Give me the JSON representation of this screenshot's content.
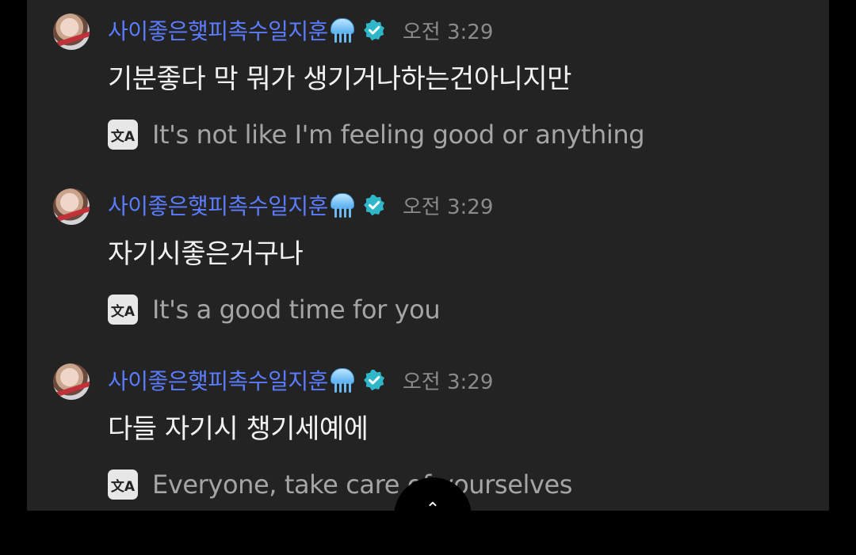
{
  "messages": [
    {
      "username": "사이좋은햋피촉수일지훈",
      "time": "오전 3:29",
      "text": "기분좋다 막 뭐가 생기거나하는건아니지만",
      "translation": "It's not like I'm feeling good or anything"
    },
    {
      "username": "사이좋은햋피촉수일지훈",
      "time": "오전 3:29",
      "text": "자기시좋은거구나",
      "translation": "It's a good time for you"
    },
    {
      "username": "사이좋은햋피촉수일지훈",
      "time": "오전 3:29",
      "text": "다들 자기시 챙기세예에",
      "translation": "Everyone, take care of yourselves"
    }
  ],
  "translate_icon": {
    "glyph": "文A",
    "name": "translate-icon"
  },
  "username_emoji": "jellyfish-emoji",
  "badge_icon": "verified-badge-icon",
  "colors": {
    "background": "#232323",
    "username": "#5b7cff",
    "verified_badge": "#2fb7c9",
    "message_text": "#f1f1f1",
    "translation_text": "#a5a5a5",
    "time_text": "#8b8b8b"
  }
}
